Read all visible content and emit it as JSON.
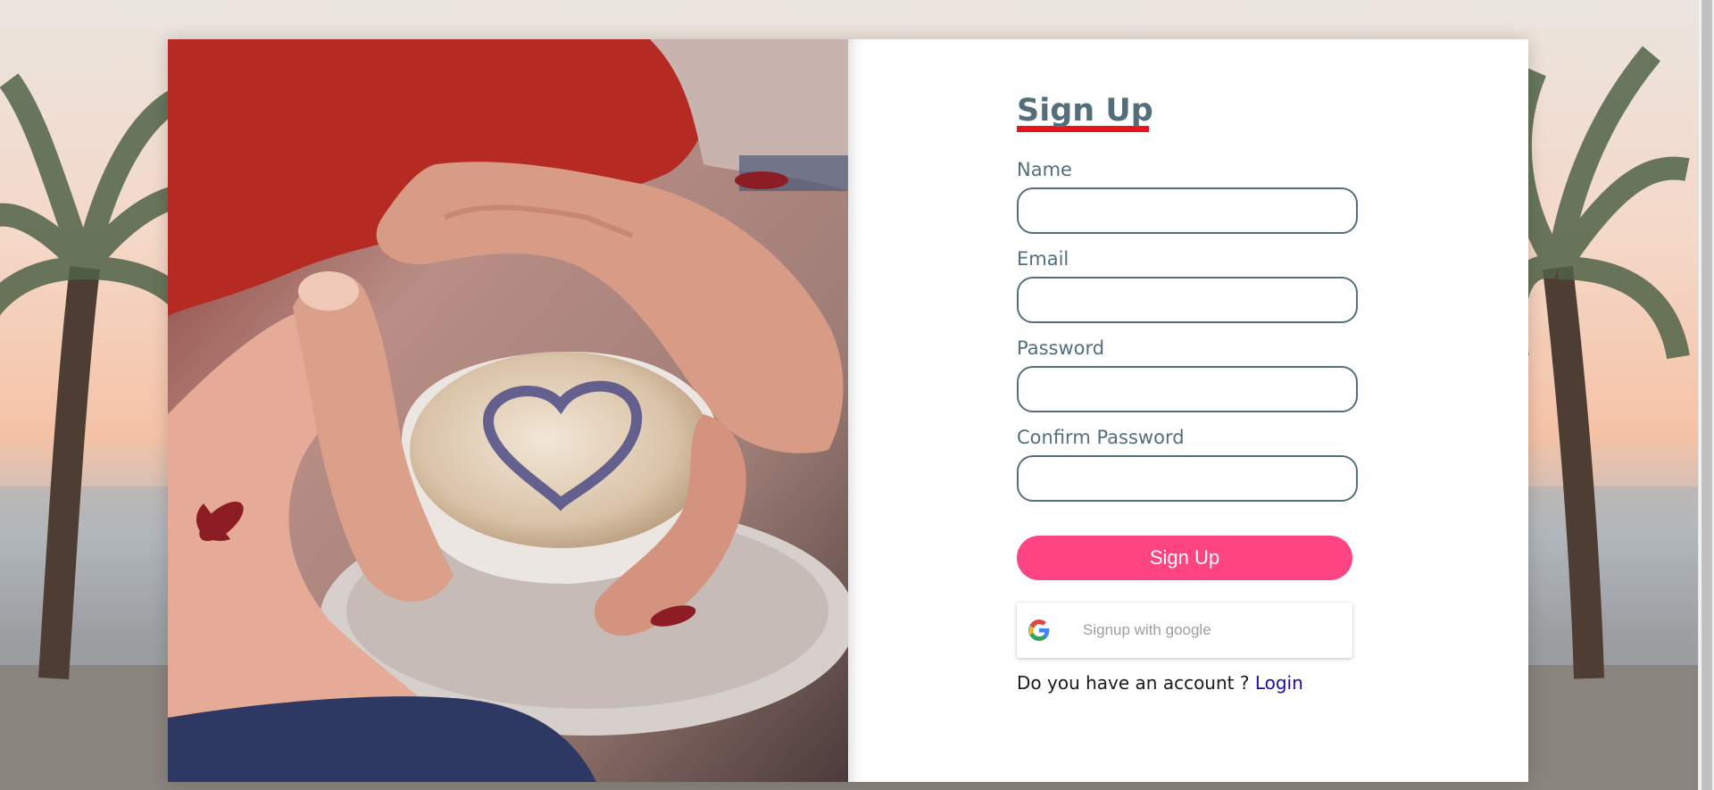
{
  "form": {
    "title": "Sign Up",
    "fields": [
      {
        "label": "Name",
        "value": "",
        "placeholder": ""
      },
      {
        "label": "Email",
        "value": "",
        "placeholder": ""
      },
      {
        "label": "Password",
        "value": "",
        "placeholder": ""
      },
      {
        "label": "Confirm Password",
        "value": "",
        "placeholder": ""
      }
    ],
    "submit_label": "Sign Up",
    "google_label": "Signup with google",
    "account_prompt": "Do you have an account ?",
    "login_label": "Login"
  },
  "icons": {
    "google": "google-icon"
  },
  "colors": {
    "accent": "#ff4581",
    "title": "#546e7a",
    "underline": "#e8141b",
    "link": "#1a0dab"
  }
}
